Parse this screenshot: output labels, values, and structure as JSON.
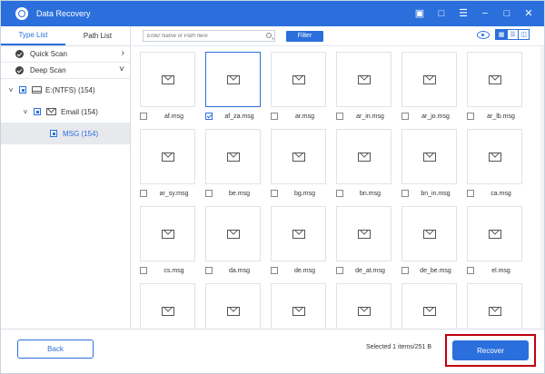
{
  "app": {
    "title": "Data Recovery"
  },
  "sidebar": {
    "tabs": [
      {
        "label": "Type List",
        "active": true
      },
      {
        "label": "Path List",
        "active": false
      }
    ],
    "scans": [
      {
        "label": "Quick Scan"
      },
      {
        "label": "Deep Scan"
      }
    ],
    "tree": [
      {
        "label": "E:(NTFS) (154)",
        "icon": "drive-icon"
      },
      {
        "label": "Email (154)",
        "icon": "mail-icon"
      },
      {
        "label": "MSG (154)",
        "selected": true
      }
    ]
  },
  "toolbar": {
    "search_placeholder": "Enter Name or Path here",
    "filter_label": "Filter",
    "view_modes": [
      "thumbnail-view",
      "list-view",
      "detail-view"
    ]
  },
  "files": [
    {
      "name": "af.msg",
      "checked": false
    },
    {
      "name": "af_za.msg",
      "checked": true
    },
    {
      "name": "ar.msg",
      "checked": false
    },
    {
      "name": "ar_in.msg",
      "checked": false
    },
    {
      "name": "ar_jo.msg",
      "checked": false
    },
    {
      "name": "ar_lb.msg",
      "checked": false
    },
    {
      "name": "ar_sy.msg",
      "checked": false
    },
    {
      "name": "be.msg",
      "checked": false
    },
    {
      "name": "bg.msg",
      "checked": false
    },
    {
      "name": "bn.msg",
      "checked": false
    },
    {
      "name": "bn_in.msg",
      "checked": false
    },
    {
      "name": "ca.msg",
      "checked": false
    },
    {
      "name": "cs.msg",
      "checked": false
    },
    {
      "name": "da.msg",
      "checked": false
    },
    {
      "name": "de.msg",
      "checked": false
    },
    {
      "name": "de_at.msg",
      "checked": false
    },
    {
      "name": "de_be.msg",
      "checked": false
    },
    {
      "name": "el.msg",
      "checked": false
    },
    {
      "name": "",
      "checked": false
    },
    {
      "name": "",
      "checked": false
    },
    {
      "name": "",
      "checked": false
    },
    {
      "name": "",
      "checked": false
    },
    {
      "name": "",
      "checked": false
    },
    {
      "name": "",
      "checked": false
    }
  ],
  "footer": {
    "back_label": "Back",
    "status": "Selected 1 items/251   B",
    "recover_label": "Recover"
  },
  "colors": {
    "accent": "#2b6fdc",
    "highlight_frame": "#c00010"
  }
}
